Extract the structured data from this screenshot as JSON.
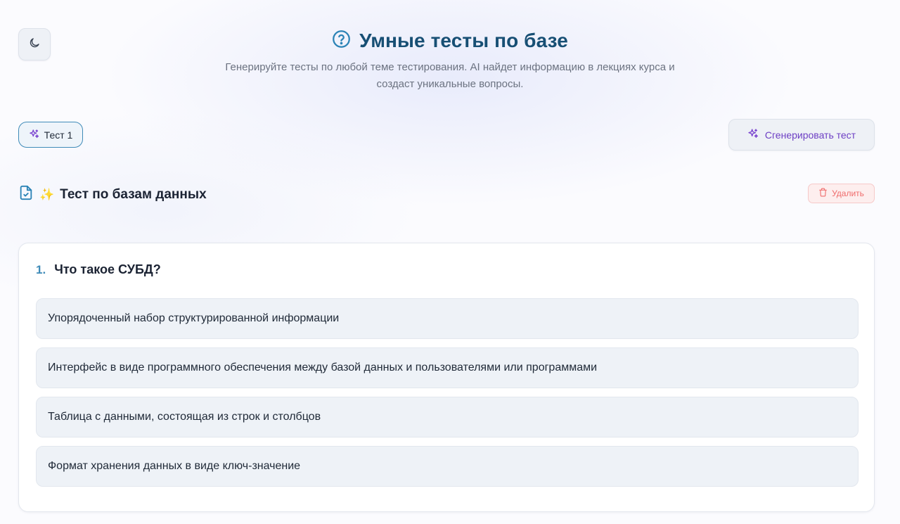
{
  "header": {
    "title": "Умные тесты по базе",
    "subtitle": "Генерируйте тесты по любой теме тестирования. AI найдет информацию в лекциях курса и создаст уникальные вопросы."
  },
  "icons": {
    "theme_toggle": "moon-icon",
    "title": "question-circle-icon",
    "tab": "sparkles-icon",
    "generate": "sparkles-icon",
    "section": "file-check-icon",
    "delete": "trash-icon"
  },
  "colors": {
    "title": "#174f74",
    "accent": "#3f8bb8",
    "generate_text": "#6d3fc4",
    "delete_text": "#ef6b6b",
    "delete_bg": "#fdeeee",
    "option_bg": "#eef2f7"
  },
  "tabs": [
    {
      "label": "Тест 1",
      "active": true
    }
  ],
  "toolbar": {
    "generate_label": "Сгенерировать тест"
  },
  "test": {
    "emoji": "✨",
    "title": "Тест по базам данных",
    "delete_label": "Удалить",
    "questions": [
      {
        "number": "1.",
        "text": "Что такое СУБД?",
        "options": [
          "Упорядоченный набор структурированной информации",
          "Интерфейс в виде программного обеспечения между базой данных и пользователями или программами",
          "Таблица с данными, состоящая из строк и столбцов",
          "Формат хранения данных в виде ключ-значение"
        ]
      }
    ]
  }
}
